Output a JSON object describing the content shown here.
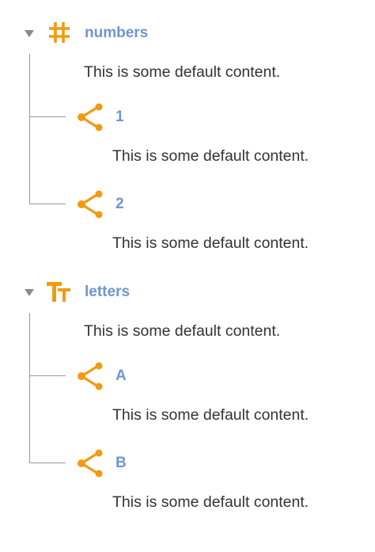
{
  "tree": [
    {
      "title": "numbers",
      "icon": "hash-icon",
      "content": "This is some default content.",
      "children": [
        {
          "title": "1",
          "icon": "share-icon",
          "content": "This is some default content."
        },
        {
          "title": "2",
          "icon": "share-icon",
          "content": "This is some default content."
        }
      ]
    },
    {
      "title": "letters",
      "icon": "text-size-icon",
      "content": "This is some default content.",
      "children": [
        {
          "title": "A",
          "icon": "share-icon",
          "content": "This is some default content."
        },
        {
          "title": "B",
          "icon": "share-icon",
          "content": "This is some default content."
        }
      ]
    }
  ],
  "colors": {
    "icon": "#f29a12",
    "title": "#6f96cf",
    "text": "#333333",
    "line": "#9a9a9a",
    "toggle": "#8a8a8a"
  }
}
